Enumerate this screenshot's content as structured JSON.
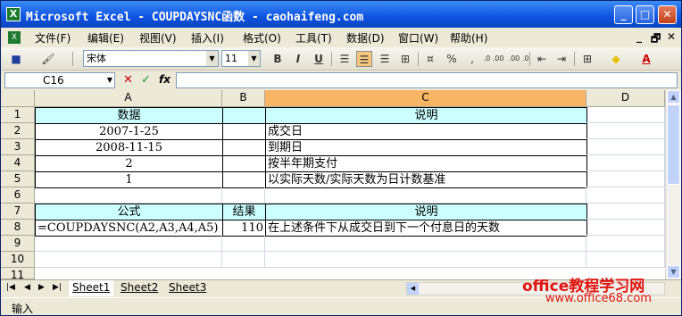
{
  "window": {
    "title": "Microsoft Excel - COUPDAYSNC函数 - caohaifeng.com",
    "minimize": "_",
    "restore": "□",
    "close": "✕",
    "mdi_min": "_",
    "mdi_restore": "🗗",
    "mdi_close": "✕"
  },
  "menu": [
    "文件(F)",
    "编辑(E)",
    "视图(V)",
    "插入(I)",
    "格式(O)",
    "工具(T)",
    "数据(D)",
    "窗口(W)",
    "帮助(H)"
  ],
  "toolbar": {
    "font": "宋体",
    "size": "11",
    "bold": "B",
    "italic": "I",
    "underline": "U",
    "percent": "%",
    "comma": ",",
    "dec_inc": ".0 .00",
    "dec_dec": ".00 .0"
  },
  "formula_bar": {
    "name_box": "C16",
    "fx": "fx",
    "cancel": "✕",
    "enter": "✓",
    "value": ""
  },
  "columns": [
    "A",
    "B",
    "C",
    "D"
  ],
  "rows": [
    "1",
    "2",
    "3",
    "4",
    "5",
    "6",
    "7",
    "8",
    "9",
    "10",
    "11"
  ],
  "cells": {
    "A1": "数据",
    "C1": "说明",
    "A2": "2007-1-25",
    "C2": "成交日",
    "A3": "2008-11-15",
    "C3": "到期日",
    "A4": "2",
    "C4": "按半年期支付",
    "A5": "1",
    "C5": "以实际天数/实际天数为日计数基准",
    "A7": "公式",
    "B7": "结果",
    "C7": "说明",
    "A8": "=COUPDAYSNC(A2,A3,A4,A5)",
    "B8": "110",
    "C8": "在上述条件下从成交日到下一个付息日的天数"
  },
  "sheets": [
    "Sheet1",
    "Sheet2",
    "Sheet3"
  ],
  "status": "输入",
  "watermark": {
    "line1": "office教程学习网",
    "line2": "www.office68.com"
  },
  "colors": {
    "header_fill": "#CCFFFF",
    "selected_col": "#F8B563",
    "title_bar": "#0F53E0"
  }
}
